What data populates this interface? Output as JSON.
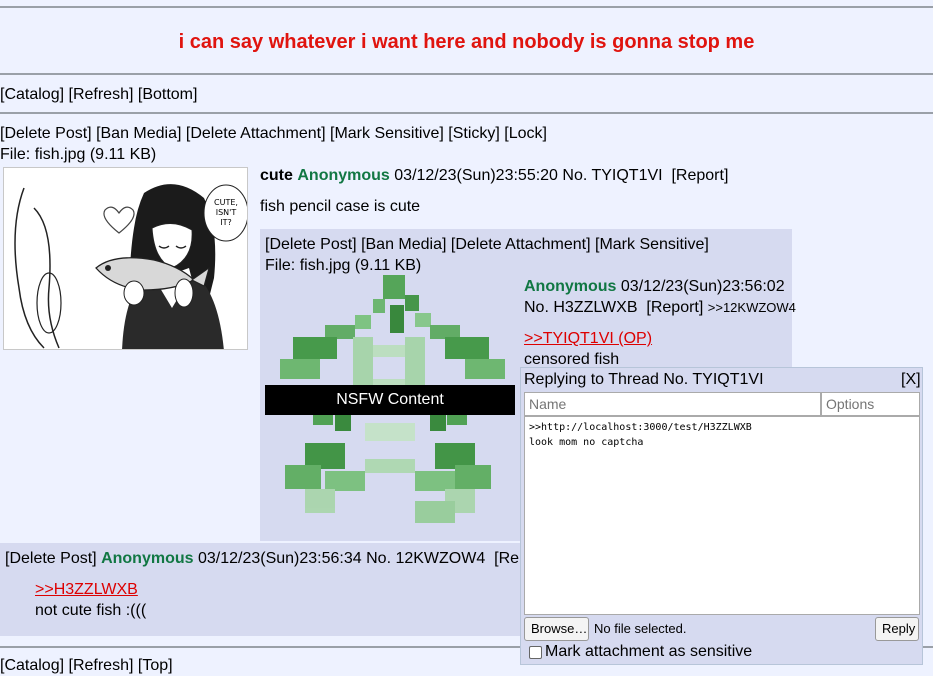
{
  "banner": "i can say whatever i want here and nobody is gonna stop me",
  "top_nav": {
    "catalog": "[Catalog]",
    "refresh": "[Refresh]",
    "bottom": "[Bottom]"
  },
  "bottom_nav": {
    "catalog": "[Catalog]",
    "refresh": "[Refresh]",
    "top": "[Top]"
  },
  "op": {
    "mod_actions": {
      "delete_post": "[Delete Post]",
      "ban_media": "[Ban Media]",
      "delete_attachment": "[Delete Attachment]",
      "mark_sensitive": "[Mark Sensitive]",
      "sticky": "[Sticky]",
      "lock": "[Lock]"
    },
    "file_label": "File:",
    "file_name": "fish.jpg",
    "file_size": "(9.11 KB)",
    "subject": "cute",
    "name": "Anonymous",
    "datetime": "03/12/23(Sun)23:55:20",
    "post_no": "No. TYIQT1VI",
    "report": "[Report]",
    "body": "fish pencil case is cute",
    "thumb_text": "CUTE, ISN'T IT?"
  },
  "reply1": {
    "mod_actions": {
      "delete_post": "[Delete Post]",
      "ban_media": "[Ban Media]",
      "delete_attachment": "[Delete Attachment]",
      "mark_sensitive": "[Mark Sensitive]"
    },
    "file_label": "File:",
    "file_name": "fish.jpg",
    "file_size": "(9.11 KB)",
    "name": "Anonymous",
    "datetime": "03/12/23(Sun)23:56:02",
    "post_no": "No. H3ZZLWXB",
    "report": "[Report]",
    "backlink": ">>12KWZOW4",
    "quote": ">>TYIQT1VI (OP)",
    "body": "censored fish",
    "nsfw_label": "NSFW Content"
  },
  "reply2": {
    "delete_post": "[Delete Post]",
    "name": "Anonymous",
    "datetime": "03/12/23(Sun)23:56:34",
    "post_no": "No. 12KWZOW4",
    "report": "[Repo",
    "quote": ">>H3ZZLWXB",
    "body": "not cute fish :((("
  },
  "quick_reply": {
    "title": "Replying to Thread No. TYIQT1VI",
    "close": "[X]",
    "name_placeholder": "Name",
    "options_placeholder": "Options",
    "comment": ">>http://localhost:3000/test/H3ZZLWXB\nlook mom no captcha",
    "browse_label": "Browse…",
    "file_status": "No file selected.",
    "reply_label": "Reply",
    "sensitive_label": "Mark attachment as sensitive"
  },
  "colors": {
    "background": "#eef2ff",
    "reply_background": "#d6daf0",
    "banner": "#e0140f",
    "name": "#117743",
    "quote_link": "#dd0000"
  }
}
